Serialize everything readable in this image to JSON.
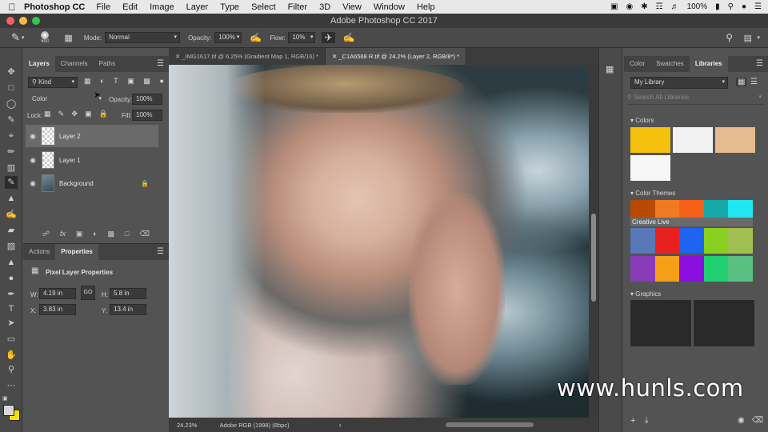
{
  "menubar": {
    "app_name": "Photoshop CC",
    "items": [
      "File",
      "Edit",
      "Image",
      "Layer",
      "Type",
      "Select",
      "Filter",
      "3D",
      "View",
      "Window",
      "Help"
    ],
    "battery": "100%"
  },
  "window": {
    "title": "Adobe Photoshop CC 2017"
  },
  "options": {
    "brush_size": "600",
    "mode_label": "Mode:",
    "mode_value": "Normal",
    "opacity_label": "Opacity:",
    "opacity_value": "100%",
    "flow_label": "Flow:",
    "flow_value": "10%"
  },
  "layers_panel": {
    "tabs": [
      "Layers",
      "Channels",
      "Paths"
    ],
    "filter_kind": "Kind",
    "blend_mode": "Color",
    "opacity_label": "Opacity:",
    "opacity_value": "100%",
    "lock_label": "Lock:",
    "fill_label": "Fill:",
    "fill_value": "100%",
    "layers": [
      {
        "name": "Layer 2",
        "selected": true
      },
      {
        "name": "Layer 1",
        "selected": false
      },
      {
        "name": "Background",
        "selected": false,
        "locked": true
      }
    ]
  },
  "properties_panel": {
    "tabs": [
      "Actions",
      "Properties"
    ],
    "title": "Pixel Layer Properties",
    "w_label": "W:",
    "w_value": "4.19 in",
    "link_label": "GO",
    "h_label": "H:",
    "h_value": "5.8 in",
    "x_label": "X:",
    "x_value": "3.83 in",
    "y_label": "Y:",
    "y_value": "13.4 in"
  },
  "documents": {
    "tabs": [
      {
        "label": "_IMG1617.tif @ 6.25% (Gradient Map 1, RGB/16) *",
        "active": false
      },
      {
        "label": "_C1A6568 R.tif @ 24.2% (Layer 2, RGB/8*) *",
        "active": true
      }
    ]
  },
  "status": {
    "zoom": "24.23%",
    "profile": "Adobe RGB (1998) (8bpc)"
  },
  "libraries_panel": {
    "tabs": [
      "Color",
      "Swatches",
      "Libraries"
    ],
    "library_name": "My Library",
    "search_placeholder": "Search All Libraries",
    "colors_label": "Colors",
    "colors": [
      "#f4c20d",
      "#f2f2f2",
      "#e6bc8e",
      "#f7f7f7"
    ],
    "themes_label": "Color Themes",
    "theme_name": "Creative Live",
    "theme1": [
      "#b84a00",
      "#f07a22",
      "#f4601a",
      "#18a8a8",
      "#22e6f2"
    ],
    "theme2": [
      "#5878b8",
      "#e82020",
      "#1e64f0",
      "#8ad020",
      "#a0c050"
    ],
    "theme3": [
      "#8a3cb8",
      "#f4a018",
      "#8a10e0",
      "#20d070",
      "#58c080"
    ],
    "graphics_label": "Graphics"
  },
  "watermark": "www.hunls.com",
  "colors": {
    "foreground": "#f4e200",
    "background": "#d8d8d8"
  }
}
